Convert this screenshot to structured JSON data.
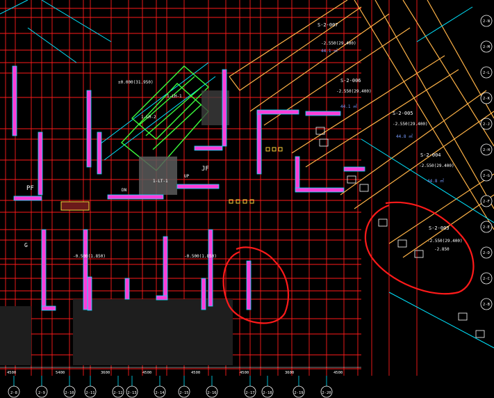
{
  "colors": {
    "background": "#000000",
    "grid": "#ff1a1a",
    "wall_fill": "#ff3dd8",
    "wall_outline": "#00e5ff",
    "diag_band": "#ffb347",
    "green": "#3cff3c",
    "text": "#ffffff",
    "markup": "#ff1a1a"
  },
  "room_labels": {
    "s2007": "S-2-007",
    "s2006": "S-2-006",
    "s2005": "S-2-005",
    "s2004": "S-2-004",
    "s2003": "S-2-003",
    "pf": "PF",
    "jf": "JF",
    "g": "G"
  },
  "elevation_labels": {
    "e1": "-2.550(29.400)",
    "e2": "-2.550(29.400)",
    "e3": "-2.550(29.400)",
    "e4": "-2.550(29.400)",
    "e5": "-2.550(29.400)",
    "e6": "-0.500(1.850)",
    "e7": "-0.500(1.850)",
    "e8": "±0.000(31.950)",
    "e9": "-2.850",
    "e10": "44.1 ㎡",
    "e11": "44.1 ㎡",
    "e12": "44.8 ㎡",
    "e13": "44.8 ㎡"
  },
  "callouts": {
    "c1": "1-LH-1",
    "c2": "1-LH-2",
    "c3": "1-LT-1",
    "c4": "DN",
    "c5": "UP",
    "c6": "JF"
  },
  "axis_bubbles": [
    "2-8",
    "2-9",
    "2-10",
    "2-11",
    "2-12",
    "2-13",
    "2-14",
    "2-15",
    "2-16",
    "2-17",
    "2-18",
    "2-19",
    "2-20"
  ],
  "right_bubbles": [
    "2-N",
    "2-M",
    "2-L",
    "2-K",
    "2-J",
    "2-H",
    "2-G",
    "2-F",
    "2-E",
    "2-D",
    "2-C",
    "2-B"
  ],
  "bottom_dims": [
    "4500",
    "5400",
    "3600",
    "4500",
    "4500",
    "4500",
    "3600",
    "4500"
  ]
}
